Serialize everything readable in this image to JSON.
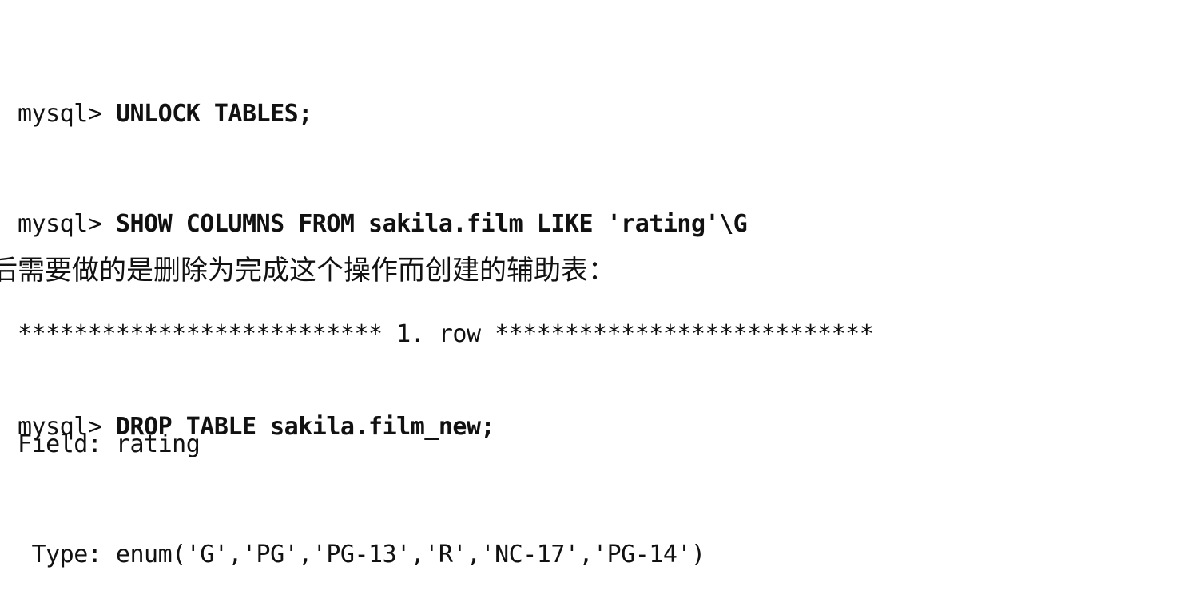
{
  "code_block_1": {
    "lines": [
      {
        "prompt": "mysql> ",
        "command": "UNLOCK TABLES;"
      },
      {
        "prompt": "mysql> ",
        "command": "SHOW COLUMNS FROM sakila.film LIKE 'rating'\\G"
      }
    ],
    "output": [
      "************************** 1. row ***************************",
      "Field: rating",
      " Type: enum('G','PG','PG-13','R','NC-17','PG-14')"
    ]
  },
  "paragraph": "后需要做的是删除为完成这个操作而创建的辅助表：",
  "code_block_2": {
    "lines": [
      {
        "prompt": "mysql> ",
        "command": "DROP TABLE sakila.film_new;"
      }
    ]
  }
}
